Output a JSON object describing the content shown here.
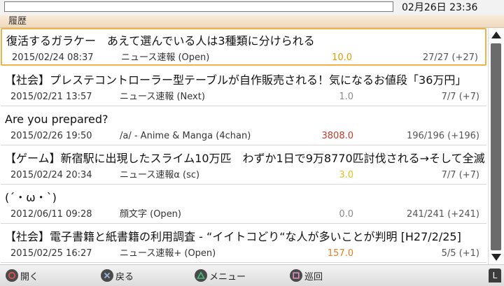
{
  "status_bar": {
    "url_value": "",
    "clock": "02月26日 23:36"
  },
  "tab": {
    "label": "履歴"
  },
  "threads": [
    {
      "title": "復活するガラケー　あえて選んでいる人は3種類に分けられる",
      "date": "2015/02/24 08:37",
      "board": "ニュース速報 (Open)",
      "score": "10.0",
      "score_color": "#e69a00",
      "count": "27/27 (+27)"
    },
    {
      "title": "【社会】プレステコントローラー型テーブルが自作販売される！気になるお値段「36万円」",
      "date": "2015/02/21 13:57",
      "board": "ニュース速報 (Next)",
      "score": "1.0",
      "score_color": "#8a8a8a",
      "count": "7/7 (+7)"
    },
    {
      "title": "Are you prepared?",
      "date": "2015/02/26 19:50",
      "board": "/a/ - Anime & Manga (4chan)",
      "score": "3808.0",
      "score_color": "#c0392b",
      "count": "196/196 (+196)"
    },
    {
      "title": "【ゲーム】新宿駅に出現したスライム10万匹　わずか1日で9万8770匹討伐される→そして全滅",
      "date": "2015/02/24 20:34",
      "board": "ニュース速報α (sc)",
      "score": "3.0",
      "score_color": "#e8c020",
      "count": "7/7 (+7)"
    },
    {
      "title": "(´・ω・`)",
      "date": "2012/06/11 09:28",
      "board": "顔文字 (Open)",
      "score": "0.0",
      "score_color": "#8a8a8a",
      "count": "241/241 (+241)"
    },
    {
      "title": "【社会】電子書籍と紙書籍の利用調査 - “イイトコどり“な人が多いことが判明 [H27/2/25]",
      "date": "2015/02/25 16:27",
      "board": "ニュース速報+ (Open)",
      "score": "157.0",
      "score_color": "#e67e22",
      "count": "5/5 (+1)"
    }
  ],
  "footer": {
    "hints": [
      {
        "icon": "circle-button-icon",
        "label": "開く",
        "color": "#e05050"
      },
      {
        "icon": "cross-button-icon",
        "label": "戻る",
        "color": "#9db4e0"
      },
      {
        "icon": "triangle-button-icon",
        "label": "メニュー",
        "color": "#40c080"
      },
      {
        "icon": "square-button-icon",
        "label": "巡回",
        "color": "#e090c0"
      }
    ],
    "l_key": "L"
  }
}
